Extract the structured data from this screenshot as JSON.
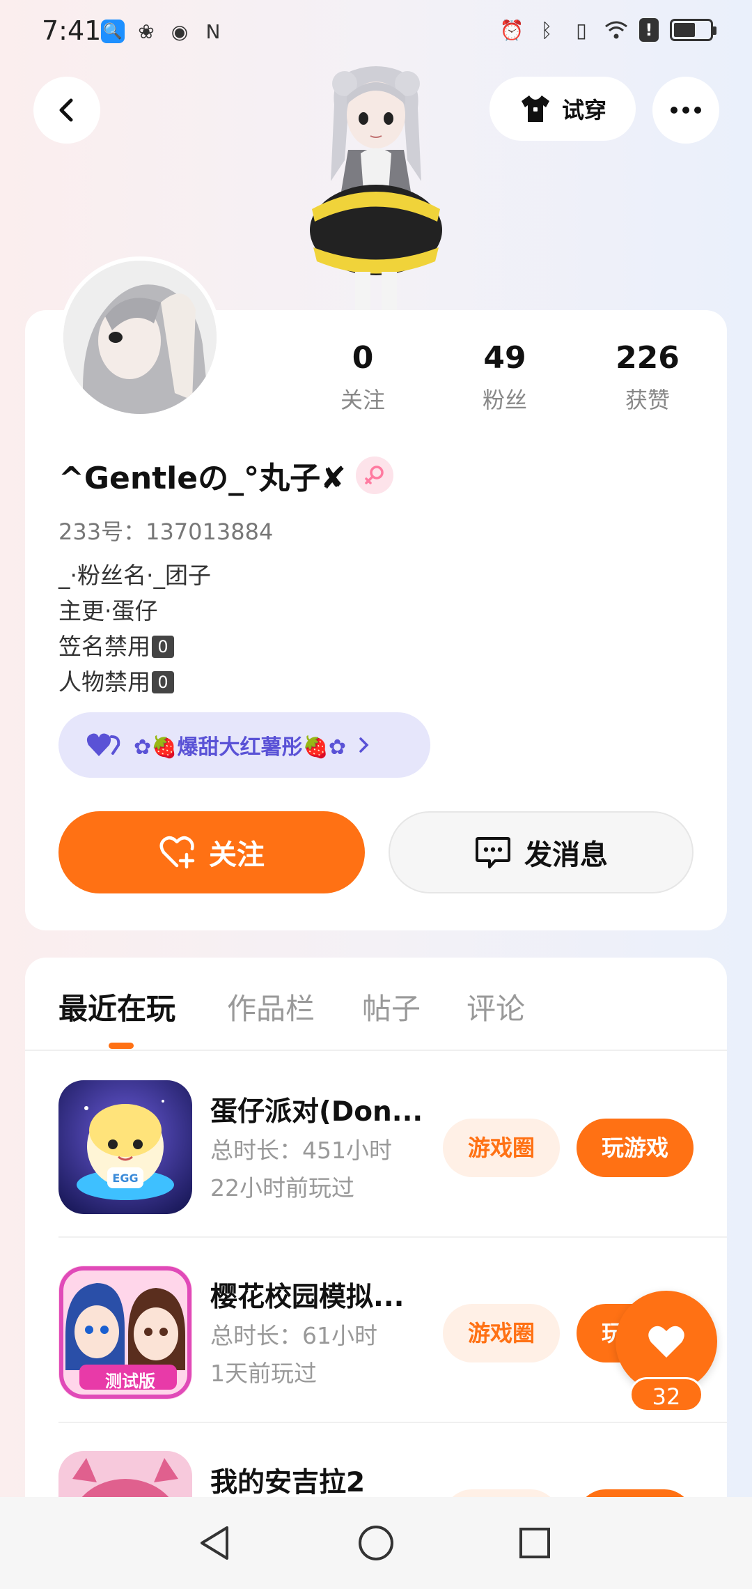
{
  "status_bar": {
    "time": "7:41"
  },
  "top_nav": {
    "tryon_label": "试穿"
  },
  "profile": {
    "stats": [
      {
        "value": "0",
        "label": "关注"
      },
      {
        "value": "49",
        "label": "粉丝"
      },
      {
        "value": "226",
        "label": "获赞"
      }
    ],
    "username": "^Gentleの_°丸子✘",
    "uid": "233号：137013884",
    "bio_lines": [
      "_·粉丝名·_团子",
      "主更·蛋仔",
      "笠名禁用",
      "人物禁用"
    ],
    "bio_box_glyph": "0",
    "fan_badge": "✿🍓爆甜大红薯彤🍓✿",
    "follow_label": "关注",
    "message_label": "发消息"
  },
  "tabs": [
    "最近在玩",
    "作品栏",
    "帖子",
    "评论"
  ],
  "games": [
    {
      "title": "蛋仔派对(Don...",
      "duration": "总时长：451小时",
      "last_played": "22小时前玩过",
      "circle_label": "游戏圈",
      "play_label": "玩游戏"
    },
    {
      "title": "樱花校园模拟...",
      "duration": "总时长：61小时",
      "last_played": "1天前玩过",
      "circle_label": "游戏圈",
      "play_label": "玩游戏"
    },
    {
      "title": "我的安吉拉2",
      "duration": "",
      "last_played": "",
      "circle_label": "",
      "play_label": ""
    }
  ],
  "game_icon_badge": "测试版",
  "like_count": "32",
  "colors": {
    "accent": "#ff7114",
    "fan_badge_text": "#5a52d6"
  }
}
